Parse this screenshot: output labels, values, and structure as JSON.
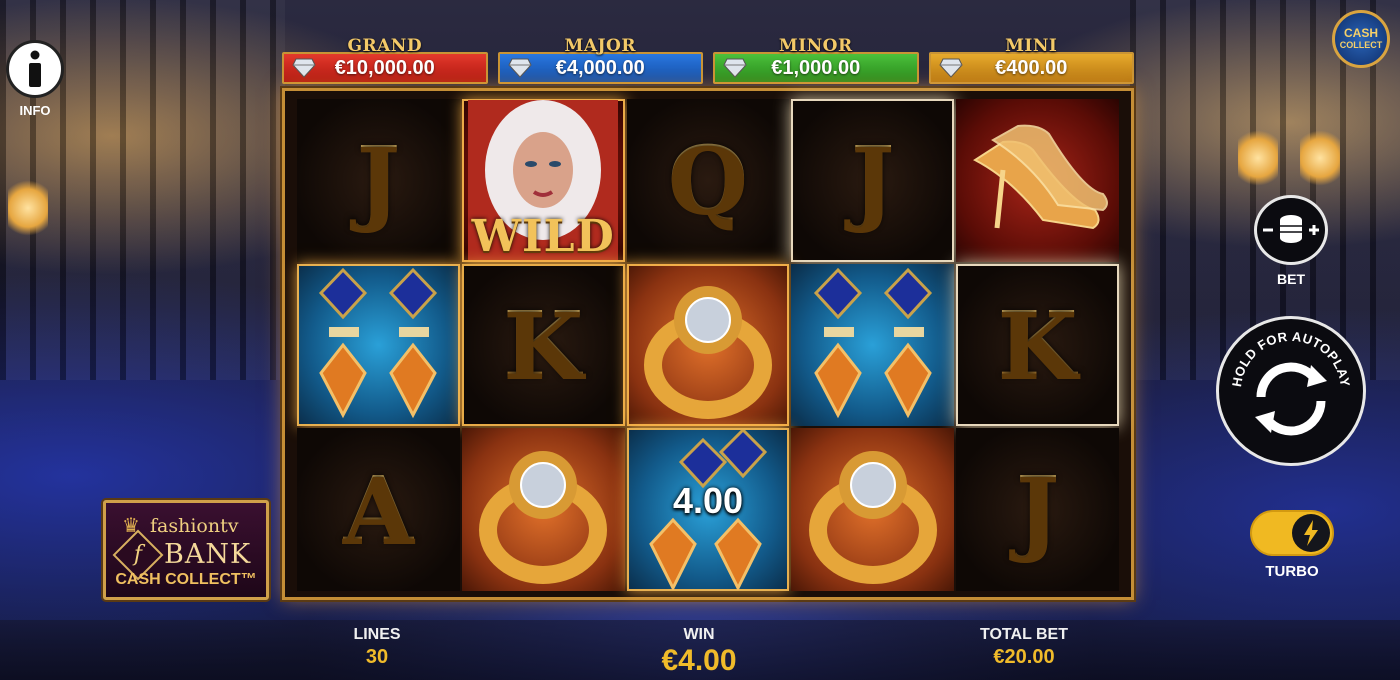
{
  "jackpots": {
    "grand": {
      "title": "GRAND",
      "amount": "€10,000.00"
    },
    "major": {
      "title": "MAJOR",
      "amount": "€4,000.00"
    },
    "minor": {
      "title": "MINOR",
      "amount": "€1,000.00"
    },
    "mini": {
      "title": "MINI",
      "amount": "€400.00"
    }
  },
  "reels": {
    "row1": [
      "J",
      "WILD",
      "Q",
      "J",
      "glass-slipper"
    ],
    "row2": [
      "gem-earrings",
      "K",
      "diamond-ring",
      "gem-earrings",
      "K"
    ],
    "row3": [
      "A",
      "diamond-ring",
      "cash-earrings",
      "diamond-ring",
      "J"
    ],
    "wild_label": "WILD",
    "cash_value": "4.00",
    "letters": {
      "r1c1": "J",
      "r1c3": "Q",
      "r1c4": "J",
      "r2c2": "K",
      "r2c5": "K",
      "r3c1": "A",
      "r3c5": "J"
    }
  },
  "bottom_bar": {
    "lines_label": "LINES",
    "lines_value": "30",
    "win_label": "WIN",
    "win_value": "€4.00",
    "total_bet_label": "TOTAL BET",
    "total_bet_value": "€20.00"
  },
  "controls": {
    "info_label": "INFO",
    "bet_label": "BET",
    "autoplay_text": "HOLD FOR AUTOPLAY",
    "turbo_label": "TURBO",
    "turbo_on": true
  },
  "cash_collect_badge": {
    "line1": "CASH",
    "line2": "COLLECT"
  },
  "game_logo": {
    "top": "fashiontv",
    "middle": "BANK",
    "bottom": "CASH COLLECT™",
    "f": "f"
  },
  "icons": [
    "info-icon",
    "coin-stack-icon",
    "autoplay-arrows-icon",
    "lightning-icon",
    "diamond-icon",
    "crown-icon"
  ],
  "colors": {
    "gold": "#f0bb2a",
    "grand": "#e43a2c",
    "major": "#2a78e0",
    "minor": "#4cc13b",
    "mini": "#e7aa2c"
  }
}
